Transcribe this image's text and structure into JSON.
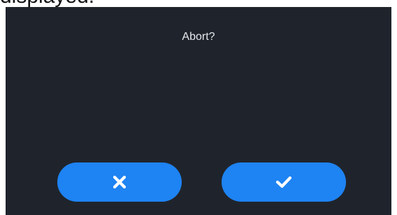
{
  "caption": {
    "text": "displayed."
  },
  "dialog": {
    "title": "Abort?",
    "buttons": {
      "cancel": {
        "icon": "close-icon"
      },
      "confirm": {
        "icon": "check-icon"
      }
    }
  },
  "colors": {
    "dialog_background": "#1f242c",
    "button_accent": "#1e83f3",
    "icon": "#ffffff",
    "title_text": "#e6e8ec"
  }
}
